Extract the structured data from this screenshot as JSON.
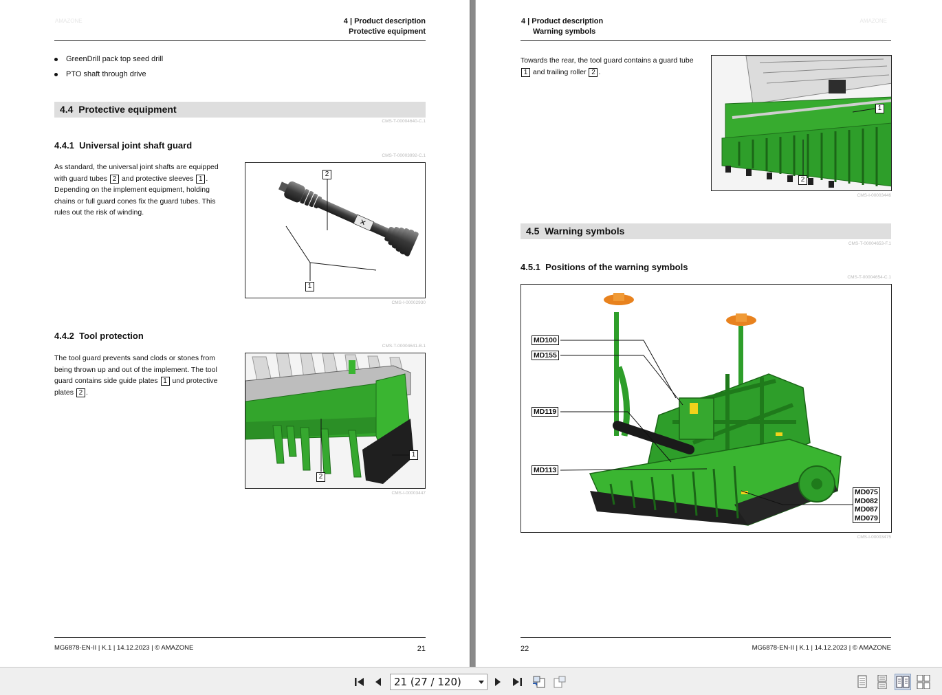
{
  "left_page": {
    "header": {
      "chapter": "4 | Product description",
      "section": "Protective equipment"
    },
    "bullets": [
      "GreenDrill pack top seed drill",
      "PTO shaft through drive"
    ],
    "section": {
      "number": "4.4",
      "title": "Protective equipment",
      "ref": "CMS-T-00004640-C.1"
    },
    "sub1": {
      "number": "4.4.1",
      "title": "Universal joint shaft guard",
      "ref": "CMS-T-00003992-C.1",
      "text_a": "As standard, the universal joint shafts are equipped with guard tubes",
      "text_b": "and protective sleeves",
      "text_c": ". Depending on the implement equipment, holding chains or full guard cones fix the guard tubes. This rules out the risk of winding.",
      "num_a": "2",
      "num_b": "1",
      "figure": {
        "callout_top": "2",
        "callout_bottom": "1",
        "ref": "CMS-I-00002930"
      }
    },
    "sub2": {
      "number": "4.4.2",
      "title": "Tool protection",
      "ref": "CMS-T-00004641-B.1",
      "text_a": "The tool guard prevents sand clods or stones from being thrown up and out of the implement. The tool guard contains side guide plates",
      "text_b": "und protective plates",
      "text_c": ".",
      "num_a": "1",
      "num_b": "2",
      "figure": {
        "callout_right": "1",
        "callout_bottom": "2",
        "ref": "CMS-I-00003447"
      }
    },
    "footer": {
      "doc": "MG6878-EN-II | K.1 | 14.12.2023 | © AMAZONE",
      "page": "21"
    }
  },
  "right_page": {
    "header": {
      "chapter": "4 | Product description",
      "section": "Warning symbols"
    },
    "intro": {
      "text_a": "Towards the rear, the tool guard contains a guard tube",
      "text_b": "and trailing roller",
      "text_c": ".",
      "num_a": "1",
      "num_b": "2",
      "figure": {
        "callout_top": "1",
        "callout_bottom": "2",
        "ref": "CMS-I-00003446"
      }
    },
    "section": {
      "number": "4.5",
      "title": "Warning symbols",
      "ref": "CMS-T-00004653-F.1"
    },
    "sub1": {
      "number": "4.5.1",
      "title": "Positions of the warning symbols",
      "ref": "CMS-T-00004654-C.1",
      "figure": {
        "labels_left": [
          "MD100",
          "MD155",
          "MD119",
          "MD113"
        ],
        "labels_right": [
          "MD075",
          "MD082",
          "MD087",
          "MD079"
        ],
        "ref": "CMS-I-00003475"
      }
    },
    "footer": {
      "doc": "MG6878-EN-II | K.1 | 14.12.2023 | © AMAZONE",
      "page": "22"
    }
  },
  "toolbar": {
    "page_value": "21 (27 / 120)",
    "icons": [
      "first-page-icon",
      "previous-page-icon",
      "next-page-icon",
      "last-page-icon",
      "go-back-icon",
      "go-forward-icon",
      "single-page-view-icon",
      "continuous-view-icon",
      "facing-pages-view-icon",
      "continuous-facing-view-icon"
    ],
    "colors": {
      "machine_green": "#2e9e2a",
      "orange": "#e8821e",
      "bar_gray": "#dedede"
    }
  }
}
